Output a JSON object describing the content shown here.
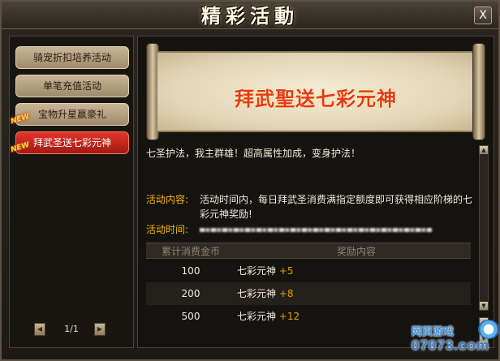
{
  "window": {
    "title": "精彩活動",
    "close_label": "X"
  },
  "sidebar": {
    "items": [
      {
        "label": "骑宠折扣培养活动",
        "active": false,
        "new": false
      },
      {
        "label": "单笔充值活动",
        "active": false,
        "new": false
      },
      {
        "label": "宝物升星嬴豪礼",
        "active": false,
        "new": true
      },
      {
        "label": "拜武圣送七彩元神",
        "active": true,
        "new": true
      }
    ],
    "new_badge": "NEW",
    "pager": {
      "text": "1/1",
      "prev_icon": "◀",
      "next_icon": "▶"
    }
  },
  "main": {
    "banner_title": "拜武聖送七彩元神",
    "intro": "七圣护法，我主群雄！超高属性加成，变身护法！",
    "desc_label": "活动内容:",
    "desc_text": "活动时间内，每日拜武圣消费满指定额度即可获得相应阶梯的七彩元神奖励!",
    "time_label": "活动时间:",
    "table": {
      "headers": [
        "累计消费金币",
        "奖励内容"
      ],
      "rows": [
        {
          "amount": "100",
          "reward": "七彩元神",
          "bonus": "+5"
        },
        {
          "amount": "200",
          "reward": "七彩元神",
          "bonus": "+8"
        },
        {
          "amount": "500",
          "reward": "七彩元神",
          "bonus": "+12"
        }
      ]
    }
  },
  "watermark": {
    "top": "网页游戏",
    "domain": "07073.com"
  },
  "colors": {
    "accent_label": "#f5b800",
    "active_tab": "#e3342a",
    "banner_text": "#e43a1c"
  }
}
